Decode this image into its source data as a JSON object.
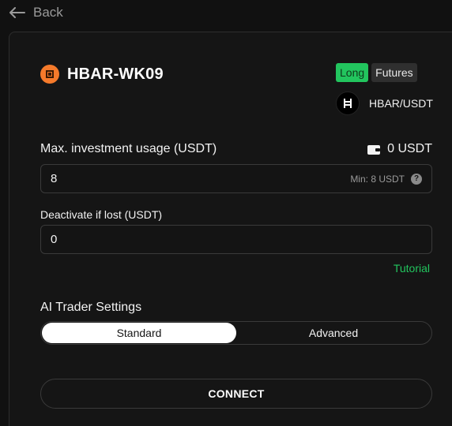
{
  "nav": {
    "back_label": "Back"
  },
  "bot": {
    "name": "HBAR-WK09",
    "tags": {
      "direction": "Long",
      "market": "Futures"
    },
    "pair": "HBAR/USDT"
  },
  "investment": {
    "label": "Max. investment usage (USDT)",
    "balance": "0 USDT",
    "value": "8",
    "min_hint": "Min: 8 USDT"
  },
  "stop_loss": {
    "label": "Deactivate if lost (USDT)",
    "value": "0",
    "tutorial_link": "Tutorial"
  },
  "settings": {
    "heading": "AI Trader Settings",
    "options": [
      "Standard",
      "Advanced"
    ],
    "selected": "Standard"
  },
  "actions": {
    "connect_label": "CONNECT"
  },
  "colors": {
    "accent_green": "#22c55e",
    "token_orange": "#f57a2b",
    "background": "#111111"
  }
}
